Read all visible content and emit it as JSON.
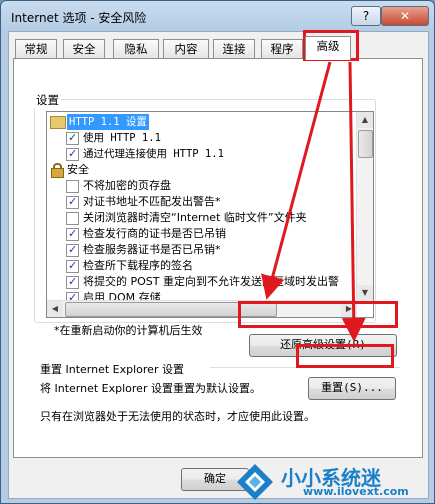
{
  "window": {
    "title": "Internet 选项 - 安全风险",
    "help_label": "?",
    "close_label": "✕"
  },
  "tabs": [
    {
      "label": "常规"
    },
    {
      "label": "安全"
    },
    {
      "label": "隐私"
    },
    {
      "label": "内容"
    },
    {
      "label": "连接"
    },
    {
      "label": "程序"
    },
    {
      "label": "高级"
    }
  ],
  "settings": {
    "group_title": "设置",
    "items": [
      {
        "label": "HTTP 1.1 设置",
        "icon": "folder-icon",
        "selected": true
      },
      {
        "label": "使用 HTTP 1.1",
        "checked": true
      },
      {
        "label": "通过代理连接使用 HTTP 1.1",
        "checked": true
      },
      {
        "label": "安全",
        "icon": "lock-icon"
      },
      {
        "label": "不将加密的页存盘",
        "checked": false
      },
      {
        "label": "对证书地址不匹配发出警告*",
        "checked": true
      },
      {
        "label": "关闭浏览器时清空“Internet 临时文件”文件夹",
        "checked": false
      },
      {
        "label": "检查发行商的证书是否已吊销",
        "checked": true
      },
      {
        "label": "检查服务器证书是否已吊销*",
        "checked": true
      },
      {
        "label": "检查所下载程序的签名",
        "checked": true
      },
      {
        "label": "将提交的 POST 重定向到不允许发送的区域时发出警",
        "checked": true
      },
      {
        "label": "启用 DOM 存储",
        "checked": true
      }
    ],
    "restart_note": "*在重新启动你的计算机后生效",
    "restore_button": "还原高级设置(R)"
  },
  "reset": {
    "group_title": "重置 Internet Explorer 设置",
    "description": "将 Internet Explorer 设置重置为默认设置。",
    "reset_button": "重置(S)...",
    "note": "只有在浏览器处于无法使用的状态时，才应使用此设置。"
  },
  "footer": {
    "ok_button": "确定"
  },
  "watermark": {
    "text": "小小系统迷",
    "url": "www.ilovext.com"
  },
  "annotation_color": "#e0191e",
  "accent_color": "#3399ff"
}
